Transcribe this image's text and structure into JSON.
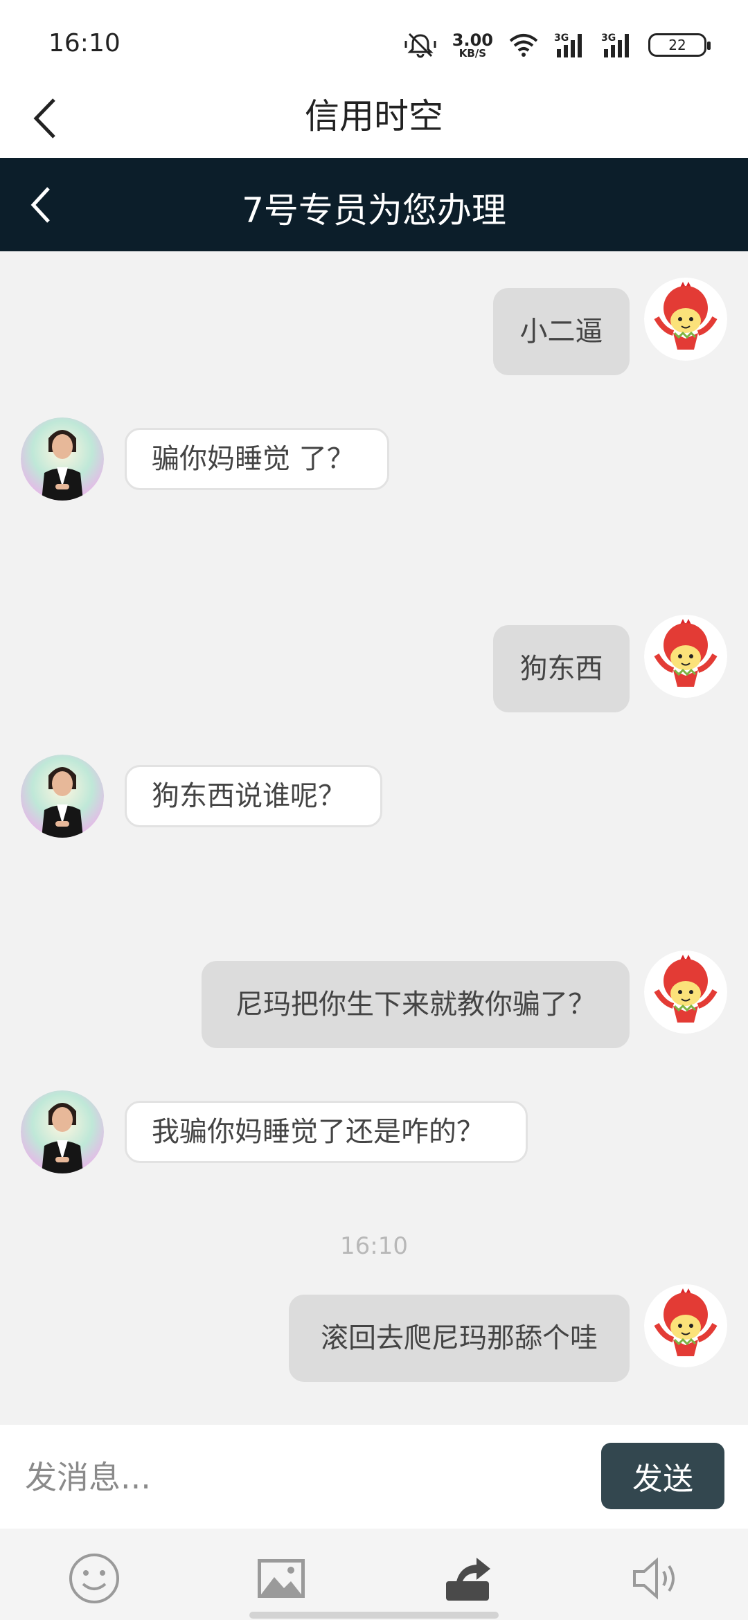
{
  "status_bar": {
    "time": "16:10",
    "speed_value": "3.00",
    "speed_unit": "KB/S",
    "network_1": "3G",
    "network_2": "3G",
    "battery": "22",
    "icons": [
      "mute-vibrate-icon",
      "wifi-icon",
      "signal-icon",
      "signal-icon",
      "battery-icon"
    ]
  },
  "app_bar": {
    "title": "信用时空",
    "back_icon": "chevron-left-icon"
  },
  "chat_header": {
    "title": "7号专员为您办理",
    "back_icon": "chevron-left-icon"
  },
  "messages": [
    {
      "side": "right",
      "text": "小二逼"
    },
    {
      "side": "left",
      "text": "骗你妈睡觉 了？"
    },
    {
      "side": "right",
      "text": "狗东西"
    },
    {
      "side": "left",
      "text": "狗东西说谁呢？"
    },
    {
      "side": "right",
      "text": "尼玛把你生下来就教你骗了？"
    },
    {
      "side": "left",
      "text": "我骗你妈睡觉了还是咋的？"
    },
    {
      "side": "right",
      "text": "滚回去爬尼玛那舔个哇"
    }
  ],
  "timestamp": "16:10",
  "input": {
    "placeholder": "发消息...",
    "value": ""
  },
  "send_label": "发送",
  "toolbar": [
    "emoji-icon",
    "image-icon",
    "share-icon",
    "speaker-icon"
  ],
  "colors": {
    "header_bg": "#0c1e2a",
    "send_bg": "#33474f",
    "chat_bg": "#f2f2f2",
    "right_bubble": "#dcdcdc"
  }
}
